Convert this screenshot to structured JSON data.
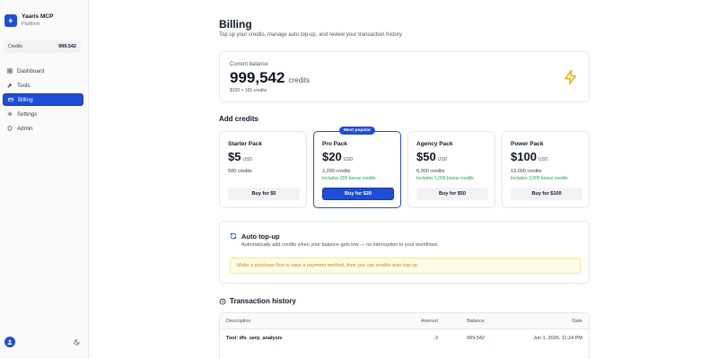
{
  "sidebar": {
    "brand_name": "Yaaris MCP",
    "brand_sub": "Platform",
    "credits_label": "Credits",
    "credits_value": "999,542",
    "nav": [
      {
        "label": "Dashboard",
        "icon": "grid-icon"
      },
      {
        "label": "Tools",
        "icon": "wrench-icon"
      },
      {
        "label": "Billing",
        "icon": "credit-card-icon"
      },
      {
        "label": "Settings",
        "icon": "gear-icon"
      },
      {
        "label": "Admin",
        "icon": "shield-icon"
      }
    ],
    "active_item": "Billing"
  },
  "page": {
    "title": "Billing",
    "subtitle": "Top up your credits, manage auto top-up, and review your transaction history."
  },
  "balance": {
    "label": "Current balance",
    "value": "999,542",
    "unit": "credits",
    "detail": "$100 + 100 credits"
  },
  "add_credits": {
    "title": "Add credits",
    "packs": [
      {
        "name": "Starter Pack",
        "price": "$5",
        "currency": "USD",
        "credits": "500 credits",
        "bonus": "",
        "button": "Buy for $5",
        "badge": ""
      },
      {
        "name": "Pro Pack",
        "price": "$20",
        "currency": "USD",
        "credits": "2,200 credits",
        "bonus": "Includes 200 bonus credits",
        "button": "Buy for $20",
        "badge": "Most popular"
      },
      {
        "name": "Agency Pack",
        "price": "$50",
        "currency": "USD",
        "credits": "6,000 credits",
        "bonus": "Includes 1,000 bonus credits",
        "button": "Buy for $50",
        "badge": ""
      },
      {
        "name": "Power Pack",
        "price": "$100",
        "currency": "USD",
        "credits": "13,000 credits",
        "bonus": "Includes 3,000 bonus credits",
        "button": "Buy for $100",
        "badge": ""
      }
    ]
  },
  "auto_topup": {
    "title": "Auto top-up",
    "description": "Automatically add credits when your balance gets low — no interruption to your workflows.",
    "note": "Make a purchase first to save a payment method, then you can enable auto top-up."
  },
  "transactions": {
    "title": "Transaction history",
    "columns": {
      "description": "Description",
      "amount": "Amount",
      "balance": "Balance",
      "date": "Date"
    },
    "rows": [
      {
        "description": "Tool: dfs_serp_analysis",
        "amount": "-3",
        "balance": "999,542",
        "date": "Jun 1, 2026, 11:24 PM"
      }
    ]
  },
  "colors": {
    "accent": "#1d4ed8",
    "bonus_green": "#16a34a",
    "warning_text": "#ca8a04",
    "bolt": "#eab308"
  }
}
